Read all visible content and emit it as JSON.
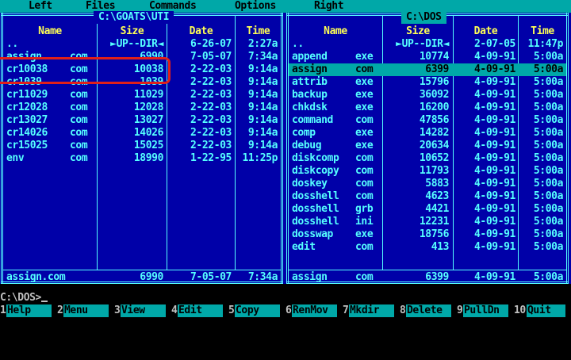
{
  "menubar": {
    "items": [
      "Left",
      "Files",
      "Commands",
      "Options",
      "Right"
    ]
  },
  "left_panel": {
    "path": "C:\\GOATS\\UTI",
    "columns": [
      "Name",
      "Size",
      "Date",
      "Time"
    ],
    "files": [
      {
        "name": "..",
        "ext": "",
        "size": "►UP--DIR◄",
        "date": "6-26-07",
        "time": "2:27a"
      },
      {
        "name": "assign",
        "ext": "com",
        "size": "6990",
        "date": "7-05-07",
        "time": "7:34a"
      },
      {
        "name": "cr10038",
        "ext": "com",
        "size": "10038",
        "date": "2-22-03",
        "time": "9:14a"
      },
      {
        "name": "cr1039",
        "ext": "com",
        "size": "1039",
        "date": "2-22-03",
        "time": "9:14a"
      },
      {
        "name": "cr11029",
        "ext": "com",
        "size": "11029",
        "date": "2-22-03",
        "time": "9:14a"
      },
      {
        "name": "cr12028",
        "ext": "com",
        "size": "12028",
        "date": "2-22-03",
        "time": "9:14a"
      },
      {
        "name": "cr13027",
        "ext": "com",
        "size": "13027",
        "date": "2-22-03",
        "time": "9:14a"
      },
      {
        "name": "cr14026",
        "ext": "com",
        "size": "14026",
        "date": "2-22-03",
        "time": "9:14a"
      },
      {
        "name": "cr15025",
        "ext": "com",
        "size": "15025",
        "date": "2-22-03",
        "time": "9:14a"
      },
      {
        "name": "env",
        "ext": "com",
        "size": "18990",
        "date": "1-22-95",
        "time": "11:25p"
      }
    ],
    "footer": {
      "name": "assign.com",
      "size": "6990",
      "date": "7-05-07",
      "time": "7:34a"
    }
  },
  "right_panel": {
    "path": "C:\\DOS",
    "columns": [
      "Name",
      "Size",
      "Date",
      "Time"
    ],
    "files": [
      {
        "name": "..",
        "ext": "",
        "size": "►UP--DIR◄",
        "date": "2-07-05",
        "time": "11:47p"
      },
      {
        "name": "append",
        "ext": "exe",
        "size": "10774",
        "date": "4-09-91",
        "time": "5:00a"
      },
      {
        "name": "assign",
        "ext": "com",
        "size": "6399",
        "date": "4-09-91",
        "time": "5:00a"
      },
      {
        "name": "attrib",
        "ext": "exe",
        "size": "15796",
        "date": "4-09-91",
        "time": "5:00a"
      },
      {
        "name": "backup",
        "ext": "exe",
        "size": "36092",
        "date": "4-09-91",
        "time": "5:00a"
      },
      {
        "name": "chkdsk",
        "ext": "exe",
        "size": "16200",
        "date": "4-09-91",
        "time": "5:00a"
      },
      {
        "name": "command",
        "ext": "com",
        "size": "47856",
        "date": "4-09-91",
        "time": "5:00a"
      },
      {
        "name": "comp",
        "ext": "exe",
        "size": "14282",
        "date": "4-09-91",
        "time": "5:00a"
      },
      {
        "name": "debug",
        "ext": "exe",
        "size": "20634",
        "date": "4-09-91",
        "time": "5:00a"
      },
      {
        "name": "diskcomp",
        "ext": "com",
        "size": "10652",
        "date": "4-09-91",
        "time": "5:00a"
      },
      {
        "name": "diskcopy",
        "ext": "com",
        "size": "11793",
        "date": "4-09-91",
        "time": "5:00a"
      },
      {
        "name": "doskey",
        "ext": "com",
        "size": "5883",
        "date": "4-09-91",
        "time": "5:00a"
      },
      {
        "name": "dosshell",
        "ext": "com",
        "size": "4623",
        "date": "4-09-91",
        "time": "5:00a"
      },
      {
        "name": "dosshell",
        "ext": "grb",
        "size": "4421",
        "date": "4-09-91",
        "time": "5:00a"
      },
      {
        "name": "dosshell",
        "ext": "ini",
        "size": "12231",
        "date": "4-09-91",
        "time": "5:00a"
      },
      {
        "name": "dosswap",
        "ext": "exe",
        "size": "18756",
        "date": "4-09-91",
        "time": "5:00a"
      },
      {
        "name": "edit",
        "ext": "com",
        "size": "413",
        "date": "4-09-91",
        "time": "5:00a"
      }
    ],
    "cursor_index": 2,
    "footer": {
      "name": "assign",
      "ext": "com",
      "size": "6399",
      "date": "4-09-91",
      "time": "5:00a"
    }
  },
  "command_line": {
    "prompt": "C:\\DOS>"
  },
  "function_keys": [
    {
      "num": "1",
      "label": "Help"
    },
    {
      "num": "2",
      "label": "Menu"
    },
    {
      "num": "3",
      "label": "View"
    },
    {
      "num": "4",
      "label": "Edit"
    },
    {
      "num": "5",
      "label": "Copy"
    },
    {
      "num": "6",
      "label": "RenMov"
    },
    {
      "num": "7",
      "label": "Mkdir"
    },
    {
      "num": "8",
      "label": "Delete"
    },
    {
      "num": "9",
      "label": "PullDn"
    },
    {
      "num": "10",
      "label": "Quit"
    }
  ],
  "colors": {
    "panel_bg": "#0000a8",
    "panel_fg": "#55ffff",
    "header_fg": "#ffff55",
    "cursor_bg": "#00a8a8",
    "annotation": "#e0201a"
  }
}
